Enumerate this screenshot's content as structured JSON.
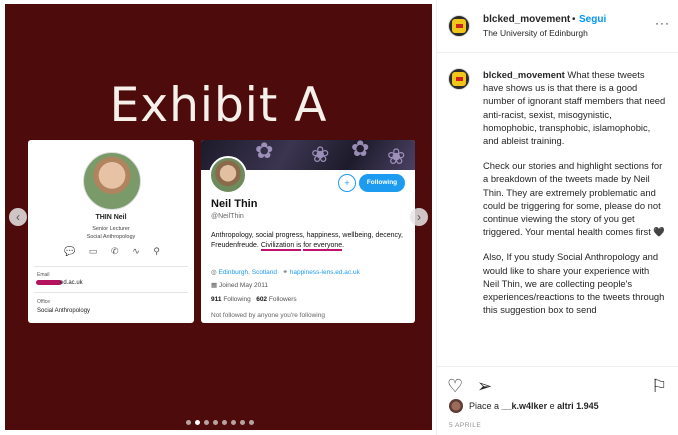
{
  "post": {
    "slide": {
      "title": "Exhibit A",
      "slide_count": 8,
      "active_slide": 2,
      "background_color": "#4e0b0b"
    },
    "uni_card": {
      "name": "THIN Neil",
      "role_line1": "Senior Lecturer",
      "role_line2": "Social Anthropology",
      "email_label": "Email",
      "email_value": "ed.ac.uk",
      "office_label": "Office",
      "office_value": "Social Anthropology",
      "icons": [
        "chat-icon",
        "video-icon",
        "phone-icon",
        "activity-icon",
        "org-chart-icon"
      ]
    },
    "twitter_card": {
      "name": "Neil Thin",
      "handle": "@NeilThin",
      "following_button": "Following",
      "bio_part1": "Anthropology, social progress, happiness, wellbeing, decency, Freudenfreude. ",
      "bio_highlight1": "Civilization is",
      "bio_highlight2": "for everyone",
      "bio_end": ".",
      "location": "Edinburgh, Scotland",
      "website": "happiness-lens.ed.ac.uk",
      "joined": "Joined May 2011",
      "following_count": "911",
      "following_label": "Following",
      "followers_count": "602",
      "followers_label": "Followers",
      "not_followed": "Not followed by anyone you're following"
    }
  },
  "header": {
    "username": "blcked_movement",
    "separator": "•",
    "follow_label": "Segui",
    "location": "The University of Edinburgh",
    "more": "···"
  },
  "caption": {
    "username": "blcked_movement",
    "p1": "What these tweets have shows us is that there is a good number of ignorant staff members that need anti-racist, sexist, misogynistic, homophobic, transphobic, islamophobic, and ableist training.",
    "p2": "Check our stories and highlight sections for a breakdown of the tweets made by Neil Thin. They are extremely problematic and could be triggering for some, please do not continue viewing the story of you get triggered. Your mental health comes first 🖤",
    "p3": "Also, If you study Social Anthropology and would like to share your experience with Neil Thin, we are collecting people's experiences/reactions to the tweets through this suggestion box to send"
  },
  "likes": {
    "prefix": "Piace a ",
    "user": "__k.w4lker",
    "middle": " e ",
    "others": "altri 1.945"
  },
  "date": "5 APRILE",
  "icons": {
    "like": "heart-icon",
    "share": "send-icon",
    "save": "bookmark-icon",
    "prev": "chevron-left-icon",
    "next": "chevron-right-icon"
  },
  "colors": {
    "accent": "#0095f6",
    "twitter_blue": "#1d9bf0",
    "highlight": "#c0116d"
  }
}
